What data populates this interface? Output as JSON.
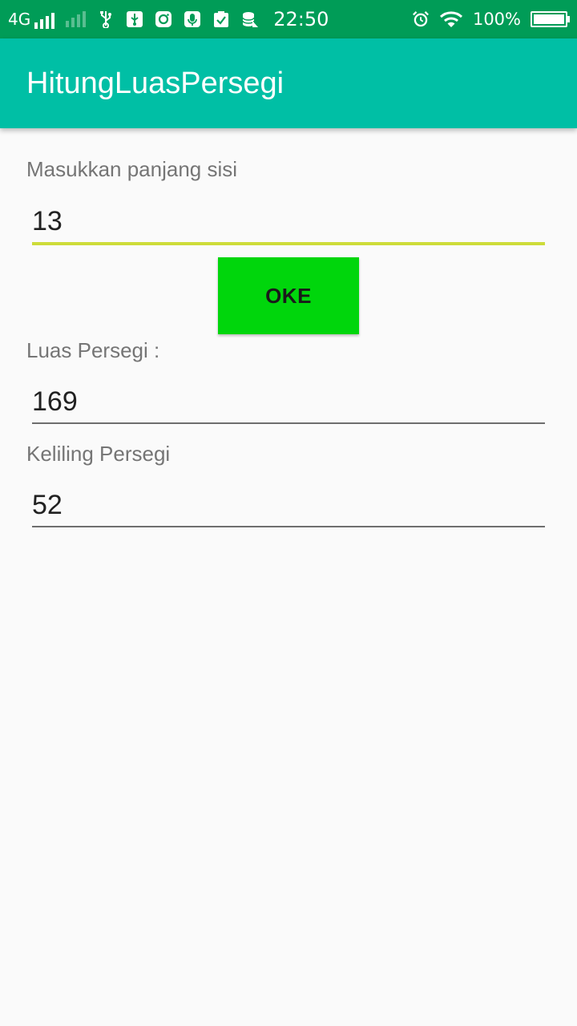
{
  "status_bar": {
    "network": "4G",
    "time": "22:50",
    "battery_percent": "100%",
    "icons": [
      "signal-icon",
      "signal-weak-icon",
      "usb-icon",
      "usb-debug-icon",
      "instagram-icon",
      "microphone-icon",
      "clipboard-check-icon",
      "database-icon",
      "alarm-icon",
      "wifi-icon",
      "battery-icon"
    ]
  },
  "app_bar": {
    "title": "HitungLuasPersegi"
  },
  "form": {
    "side_label": "Masukkan panjang sisi",
    "side_value": "13",
    "button_label": "OKE",
    "area_label": "Luas Persegi :",
    "area_value": "169",
    "perimeter_label": "Keliling Persegi",
    "perimeter_value": "52"
  },
  "colors": {
    "status_bar": "#009c57",
    "app_bar": "#00bfa5",
    "button": "#00d60c",
    "focused_underline": "#cddc39",
    "background": "#fafafa"
  }
}
